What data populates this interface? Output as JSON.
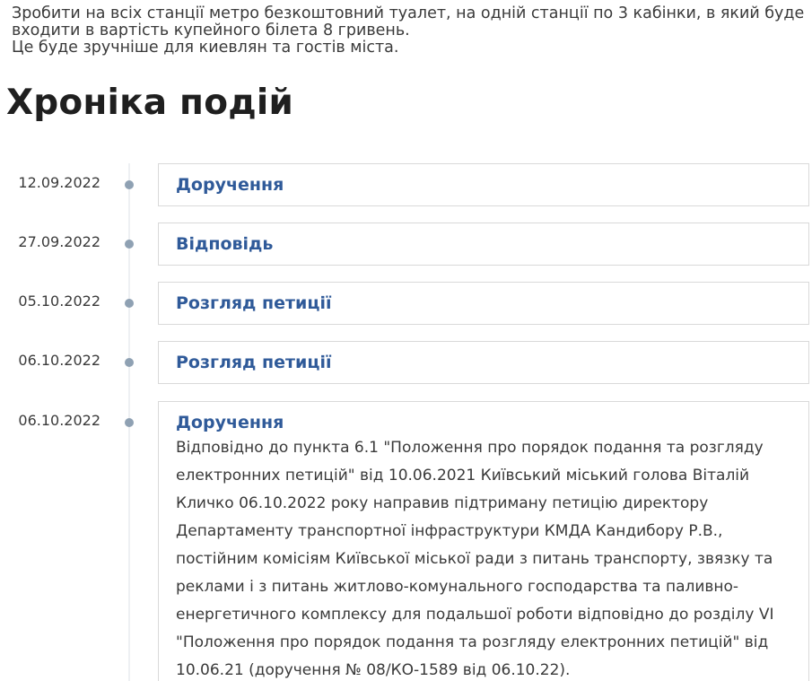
{
  "intro": {
    "text": "Зробити на всіх станції метро безкоштовний туалет, на одній станції по 3 кабінки, в який буде входити в вартість купейного білета 8 гривень.\nЦе буде зручніше для киевлян та гостів міста."
  },
  "section_title": "Хроніка подій",
  "timeline": [
    {
      "date": "12.09.2022",
      "title": "Доручення",
      "body": ""
    },
    {
      "date": "27.09.2022",
      "title": "Відповідь",
      "body": ""
    },
    {
      "date": "05.10.2022",
      "title": "Розгляд петиції",
      "body": ""
    },
    {
      "date": "06.10.2022",
      "title": "Розгляд петиції",
      "body": ""
    },
    {
      "date": "06.10.2022",
      "title": "Доручення",
      "body": "Відповідно до пункта 6.1 \"Положення про порядок подання та розгляду електронних петицій\" від 10.06.2021 Київський міський голова Віталій Кличко 06.10.2022 року  направив підтриману петицію директору Департаменту транспортної інфраструктури КМДА Кандибору Р.В., постійним комісіям Київської міської ради з питань транспорту, звязку та реклами і з питань житлово-комунального господарства та паливно-енергетичного комплексу для подальшої роботи відповідно до розділу VI \"Положення про порядок подання та розгляду електронних петицій\" від 10.06.21 (доручення № 08/КО-1589 від 06.10.22)."
    }
  ],
  "colors": {
    "link_title": "#2f5a99",
    "dot": "#8fa1b3",
    "border": "#d9d9d9"
  }
}
